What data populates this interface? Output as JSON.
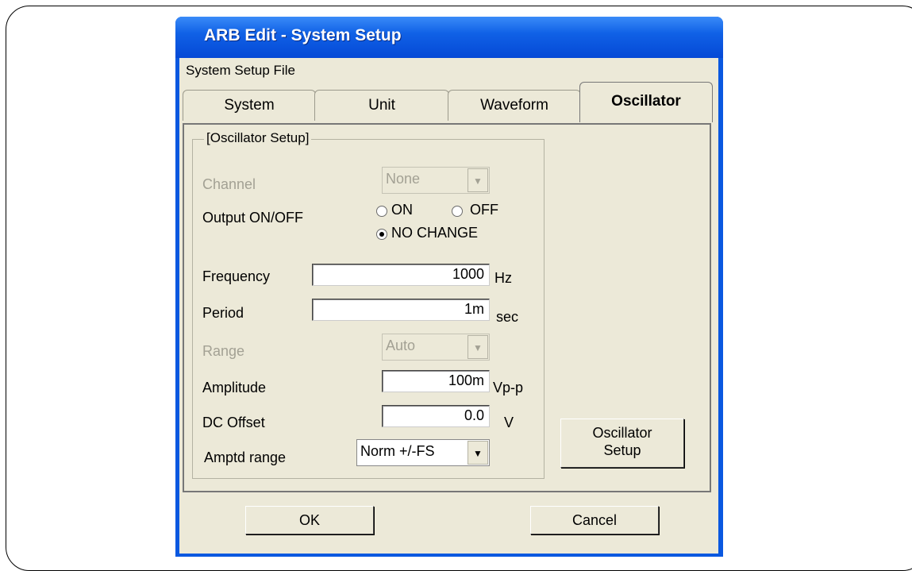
{
  "window": {
    "title": "ARB Edit - System Setup"
  },
  "menu": {
    "system_setup_file": "System Setup File"
  },
  "tabs": [
    {
      "label": "System"
    },
    {
      "label": "Unit"
    },
    {
      "label": "Waveform"
    },
    {
      "label": "Oscillator"
    }
  ],
  "group": {
    "title": "[Oscillator Setup]"
  },
  "channel": {
    "label": "Channel",
    "value": "None"
  },
  "output": {
    "label": "Output ON/OFF",
    "on": "ON",
    "off": "OFF",
    "no_change": "NO CHANGE",
    "selected": "NO CHANGE"
  },
  "frequency": {
    "label": "Frequency",
    "value": "1000",
    "unit": "Hz"
  },
  "period": {
    "label": "Period",
    "value": "1m",
    "unit": "sec"
  },
  "range": {
    "label": "Range",
    "value": "Auto"
  },
  "amplitude": {
    "label": "Amplitude",
    "value": "100m",
    "unit": "Vp-p"
  },
  "dc_offset": {
    "label": "DC Offset",
    "value": "0.0",
    "unit": "V"
  },
  "amptd_range": {
    "label": "Amptd range",
    "value": "Norm +/-FS"
  },
  "oscillator_setup_button": {
    "line1": "Oscillator",
    "line2": "Setup"
  },
  "buttons": {
    "ok": "OK",
    "cancel": "Cancel"
  }
}
